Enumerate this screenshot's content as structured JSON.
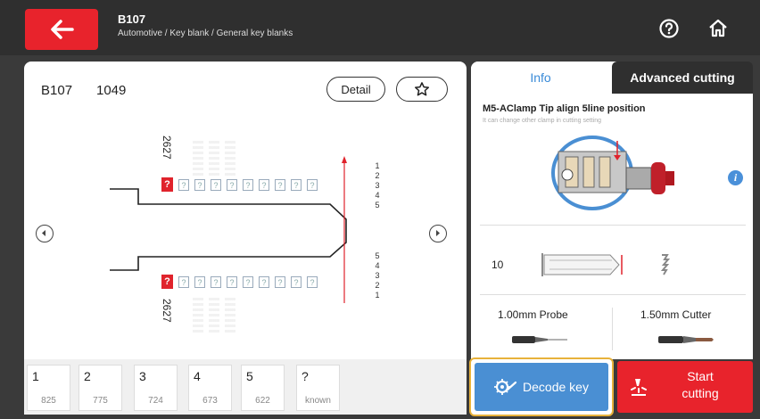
{
  "header": {
    "title": "B107",
    "breadcrumb": "Automotive / Key blank / General key blanks"
  },
  "key": {
    "name": "B107",
    "number": "1049",
    "detail_label": "Detail",
    "side_label": "2627",
    "upper_row_nums": [
      "1",
      "2",
      "3",
      "4",
      "5"
    ],
    "lower_row_nums": [
      "5",
      "4",
      "3",
      "2",
      "1"
    ],
    "unknown_mark": "?",
    "cut_cells": [
      "?",
      "?",
      "?",
      "?",
      "?",
      "?",
      "?",
      "?",
      "?"
    ]
  },
  "depths": [
    {
      "pos": "1",
      "val": "825"
    },
    {
      "pos": "2",
      "val": "775"
    },
    {
      "pos": "3",
      "val": "724"
    },
    {
      "pos": "4",
      "val": "673"
    },
    {
      "pos": "5",
      "val": "622"
    },
    {
      "pos": "?",
      "val": "known"
    }
  ],
  "tabs": {
    "info": "Info",
    "advanced": "Advanced cutting"
  },
  "info": {
    "clamp_title": "M5-AClamp Tip align 5line position",
    "clamp_note": "It can change other clamp in cutting setting",
    "probe_number": "10",
    "probe_label": "1.00mm Probe",
    "cutter_label": "1.50mm Cutter"
  },
  "actions": {
    "decode": "Decode key",
    "start_line1": "Start",
    "start_line2": "cutting"
  },
  "colors": {
    "accent_red": "#e8232c",
    "accent_blue": "#4a8fd3",
    "highlight": "#e8b23a"
  }
}
